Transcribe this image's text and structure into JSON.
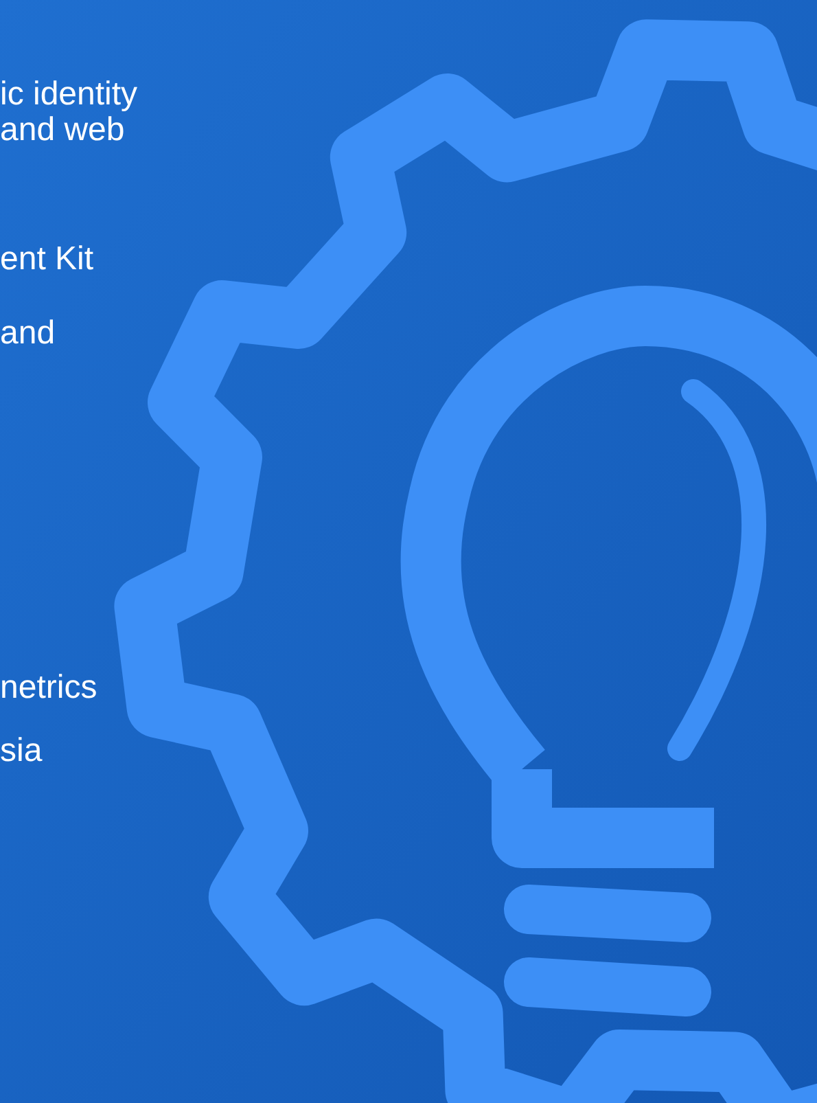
{
  "paragraphs": [
    [
      "ic identity",
      "and web"
    ],
    [
      "ent Kit"
    ],
    [
      "and"
    ],
    [
      "netrics"
    ],
    [
      "sia"
    ]
  ]
}
